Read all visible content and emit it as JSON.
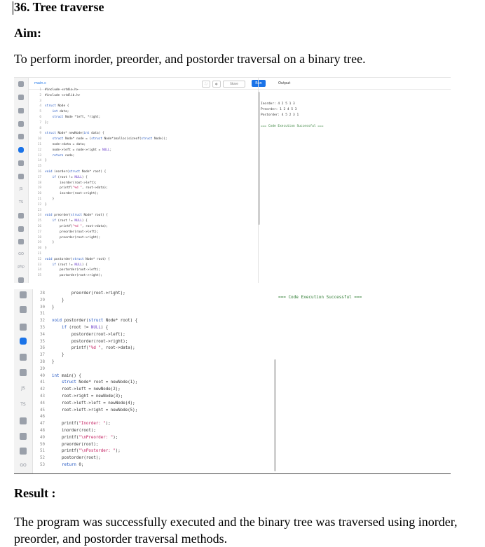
{
  "title": "36. Tree traverse",
  "aim_heading": "Aim:",
  "aim_text": "To perform inorder, preorder, and postorder traversal on a binary tree.",
  "result_heading": "Result :",
  "result_text": "The program was successfully executed and the binary tree was traversed using inorder, preorder, and postorder traversal methods.",
  "editor": {
    "file_tab": "main.c",
    "share_label": "Share",
    "run_label": "Run",
    "output_label": "Output"
  },
  "code_top": [
    {
      "n": "1",
      "t": "#include <stdio.h>"
    },
    {
      "n": "2",
      "t": "#include <stdlib.h>"
    },
    {
      "n": "3",
      "t": ""
    },
    {
      "n": "4",
      "t": "struct Node {"
    },
    {
      "n": "5",
      "t": "    int data;"
    },
    {
      "n": "6",
      "t": "    struct Node *left, *right;"
    },
    {
      "n": "7",
      "t": "};"
    },
    {
      "n": "8",
      "t": ""
    },
    {
      "n": "9",
      "t": "struct Node* newNode(int data) {"
    },
    {
      "n": "10",
      "t": "    struct Node* node = (struct Node*)malloc(sizeof(struct Node));"
    },
    {
      "n": "11",
      "t": "    node->data = data;"
    },
    {
      "n": "12",
      "t": "    node->left = node->right = NULL;"
    },
    {
      "n": "13",
      "t": "    return node;"
    },
    {
      "n": "14",
      "t": "}"
    },
    {
      "n": "15",
      "t": ""
    },
    {
      "n": "16",
      "t": "void inorder(struct Node* root) {"
    },
    {
      "n": "17",
      "t": "    if (root != NULL) {"
    },
    {
      "n": "18",
      "t": "        inorder(root->left);"
    },
    {
      "n": "19",
      "t": "        printf(\"%d \", root->data);"
    },
    {
      "n": "20",
      "t": "        inorder(root->right);"
    },
    {
      "n": "21",
      "t": "    }"
    },
    {
      "n": "22",
      "t": "}"
    },
    {
      "n": "23",
      "t": ""
    },
    {
      "n": "24",
      "t": "void preorder(struct Node* root) {"
    },
    {
      "n": "25",
      "t": "    if (root != NULL) {"
    },
    {
      "n": "26",
      "t": "        printf(\"%d \", root->data);"
    },
    {
      "n": "27",
      "t": "        preorder(root->left);"
    },
    {
      "n": "28",
      "t": "        preorder(root->right);"
    },
    {
      "n": "29",
      "t": "    }"
    },
    {
      "n": "30",
      "t": "}"
    },
    {
      "n": "31",
      "t": ""
    },
    {
      "n": "32",
      "t": "void postorder(struct Node* root) {"
    },
    {
      "n": "33",
      "t": "    if (root != NULL) {"
    },
    {
      "n": "34",
      "t": "        postorder(root->left);"
    },
    {
      "n": "35",
      "t": "        postorder(root->right);"
    }
  ],
  "output_top": [
    {
      "t": "Inorder: 4 2 5 1 3",
      "ok": false
    },
    {
      "t": "Preorder: 1 2 4 5 3",
      "ok": false
    },
    {
      "t": "Postorder: 4 5 2 3 1",
      "ok": false
    },
    {
      "t": "",
      "ok": false
    },
    {
      "t": "=== Code Execution Successful ===",
      "ok": true
    }
  ],
  "code_bottom": [
    {
      "n": "28",
      "t": "        preorder(root->right);"
    },
    {
      "n": "29",
      "t": "    }"
    },
    {
      "n": "30",
      "t": "}"
    },
    {
      "n": "31",
      "t": ""
    },
    {
      "n": "32",
      "t": "void postorder(struct Node* root) {"
    },
    {
      "n": "33",
      "t": "    if (root != NULL) {"
    },
    {
      "n": "34",
      "t": "        postorder(root->left);"
    },
    {
      "n": "35",
      "t": "        postorder(root->right);"
    },
    {
      "n": "36",
      "t": "        printf(\"%d \", root->data);"
    },
    {
      "n": "37",
      "t": "    }"
    },
    {
      "n": "38",
      "t": "}"
    },
    {
      "n": "39",
      "t": ""
    },
    {
      "n": "40",
      "t": "int main() {"
    },
    {
      "n": "41",
      "t": "    struct Node* root = newNode(1);"
    },
    {
      "n": "42",
      "t": "    root->left = newNode(2);"
    },
    {
      "n": "43",
      "t": "    root->right = newNode(3);"
    },
    {
      "n": "44",
      "t": "    root->left->left = newNode(4);"
    },
    {
      "n": "45",
      "t": "    root->left->right = newNode(5);"
    },
    {
      "n": "46",
      "t": ""
    },
    {
      "n": "47",
      "t": "    printf(\"Inorder: \");"
    },
    {
      "n": "48",
      "t": "    inorder(root);"
    },
    {
      "n": "49",
      "t": "    printf(\"\\nPreorder: \");"
    },
    {
      "n": "50",
      "t": "    preorder(root);"
    },
    {
      "n": "51",
      "t": "    printf(\"\\nPostorder: \");"
    },
    {
      "n": "52",
      "t": "    postorder(root);"
    },
    {
      "n": "53",
      "t": "    return 0;"
    }
  ],
  "output_bottom": "=== Code Execution Successful ===",
  "rail_icons": [
    "python-icon",
    "r-icon",
    "sql-icon",
    "html-icon",
    "java-icon",
    "c-icon",
    "cpp-icon",
    "csharp-icon",
    "js-icon",
    "ts-icon",
    "go-icon",
    "php-icon",
    "swift-icon",
    "rust-icon",
    "ruby-icon",
    "lua-icon"
  ],
  "rail_text": {
    "js": "JS",
    "ts": "TS",
    "go": "GO",
    "php": "php"
  },
  "colors": {
    "accent": "#1a73e8",
    "success": "#2e7d32"
  }
}
